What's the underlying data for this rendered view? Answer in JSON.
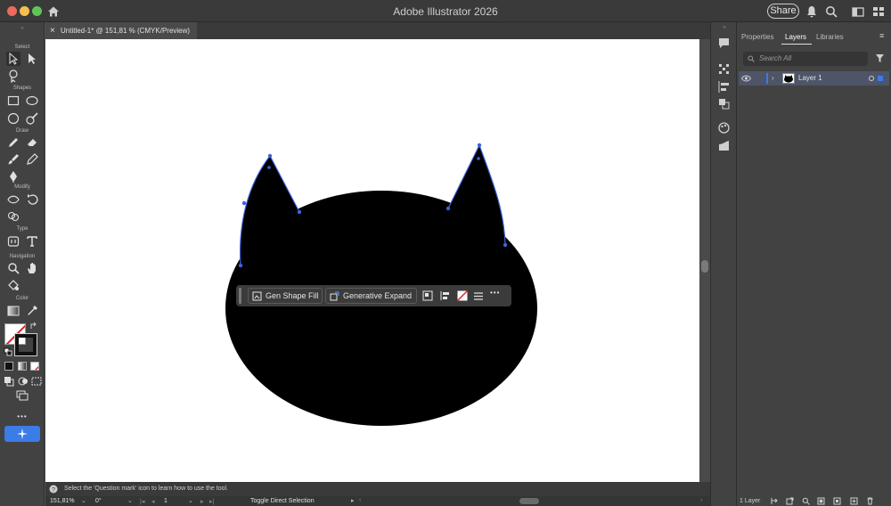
{
  "window": {
    "title": "Adobe Illustrator 2026",
    "share_label": "Share"
  },
  "document": {
    "tab_label": "Untitled-1* @ 151,81 % (CMYK/Preview)",
    "close_glyph": "×"
  },
  "toolbar": {
    "sections": [
      "Select",
      "Shapes",
      "Draw",
      "Modify",
      "Type",
      "Navigation",
      "Color"
    ],
    "more_glyph": "•••"
  },
  "context_bar": {
    "gen_shape_fill": "Gen Shape Fill",
    "generative_expand": "Generative Expand",
    "more_glyph": "•••"
  },
  "status": {
    "help_text": "Select the 'Question mark' icon to learn how to use the tool.",
    "zoom": "151,81%",
    "rotation": "0°",
    "artboard_number": "1",
    "tool_name": "Toggle Direct Selection"
  },
  "panel": {
    "tabs": [
      "Properties",
      "Layers",
      "Libraries"
    ],
    "active_tab": "Layers",
    "search_placeholder": "Search All",
    "layer_name": "Layer 1",
    "layer_count": "1 Layer"
  },
  "colors": {
    "accent": "#3b7ce6",
    "path_selection": "#3b64d9",
    "fill": "#000000"
  }
}
